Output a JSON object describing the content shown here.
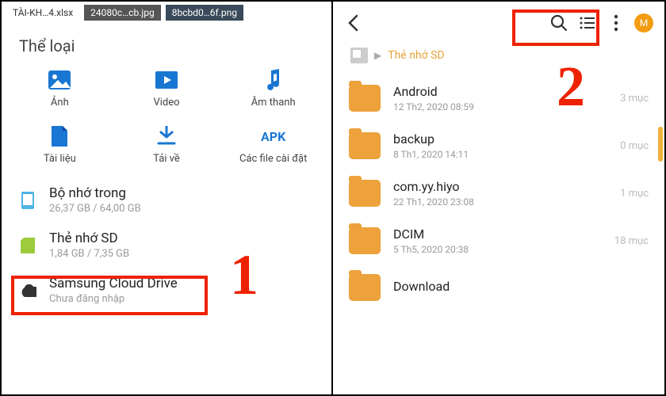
{
  "left": {
    "tabs": [
      "TÀI-KH…4.xlsx",
      "24080c…cb.jpg",
      "8bcbd0…6f.png"
    ],
    "section_title": "Thể loại",
    "categories": [
      {
        "label": "Ảnh"
      },
      {
        "label": "Video"
      },
      {
        "label": "Âm thanh"
      },
      {
        "label": "Tài liệu"
      },
      {
        "label": "Tải về"
      },
      {
        "label": "Các file cài đặt",
        "apk": "APK"
      }
    ],
    "storage": [
      {
        "name": "Bộ nhớ trong",
        "sub": "26,37 GB / 64,00 GB"
      },
      {
        "name": "Thẻ nhớ SD",
        "sub": "1,84 GB / 7,35 GB"
      },
      {
        "name": "Samsung Cloud Drive",
        "sub": "Chưa đăng nhập"
      }
    ],
    "step": "1"
  },
  "right": {
    "avatar_initial": "M",
    "breadcrumb_current": "Thẻ nhớ SD",
    "folders": [
      {
        "name": "Android",
        "sub": "12 Th2, 2020 08:59",
        "count": "3 mục"
      },
      {
        "name": "backup",
        "sub": "8 Th1, 2020 14:11",
        "count": "0 mục"
      },
      {
        "name": "com.yy.hiyo",
        "sub": "22 Th1, 2020 23:08",
        "count": "1 mục"
      },
      {
        "name": "DCIM",
        "sub": "5 Th5, 2020 20:38",
        "count": "18 mục"
      },
      {
        "name": "Download",
        "sub": "",
        "count": ""
      }
    ],
    "step": "2"
  }
}
